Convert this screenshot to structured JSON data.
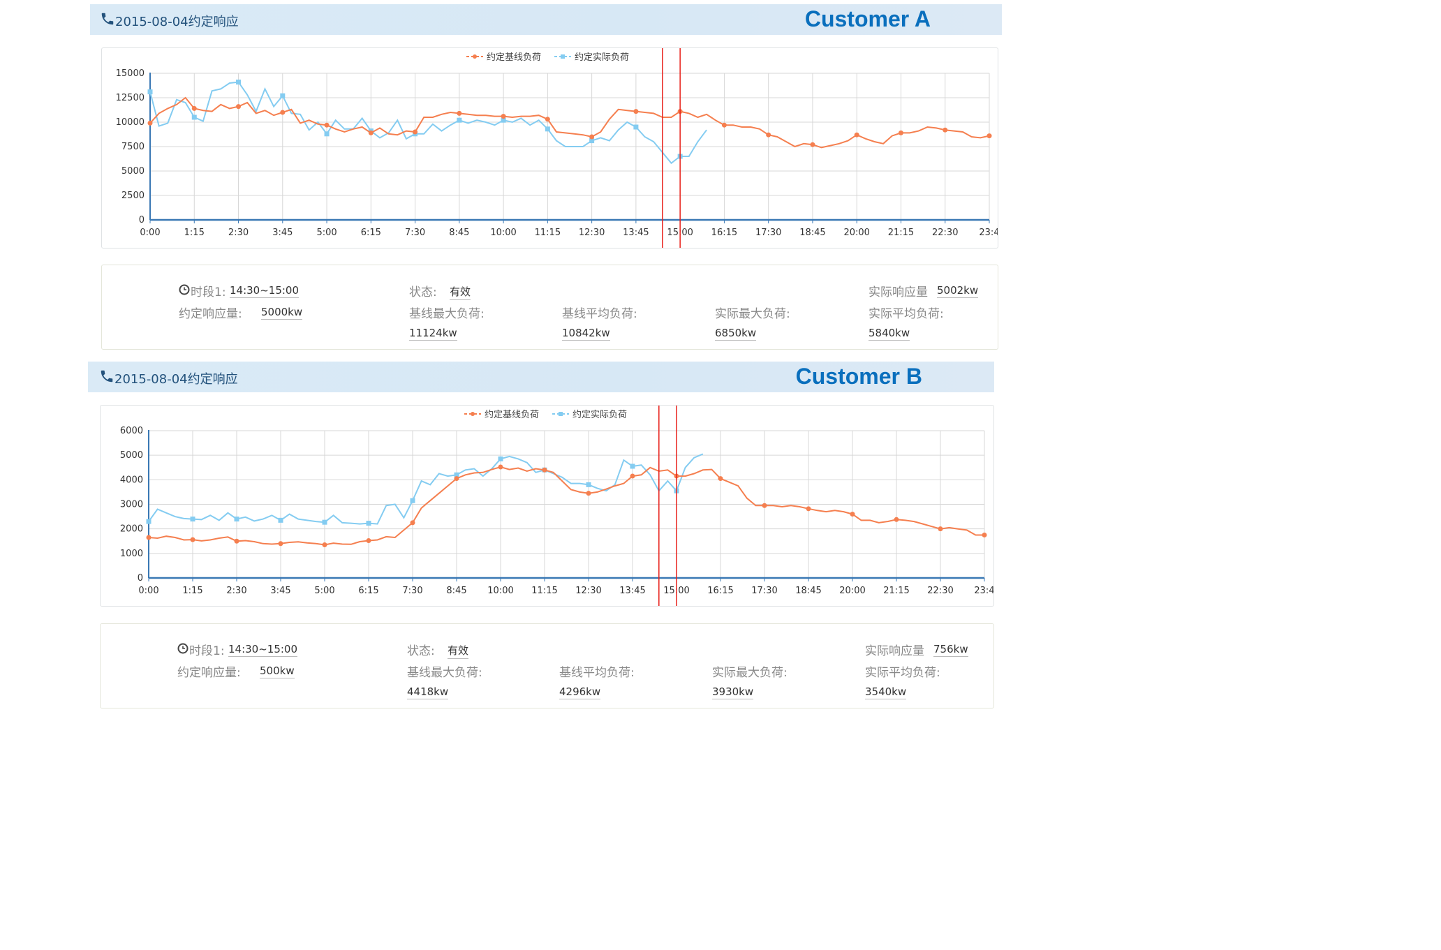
{
  "panels": [
    {
      "header": {
        "date_title": "2015-08-04约定响应",
        "customer_label": "Customer A"
      },
      "chart_data": {
        "type": "line",
        "legend": [
          "约定基线负荷",
          "约定实际负荷"
        ],
        "x_ticks": [
          "0:00",
          "1:15",
          "2:30",
          "3:45",
          "5:00",
          "6:15",
          "7:30",
          "8:45",
          "10:00",
          "11:15",
          "12:30",
          "13:45",
          "15:00",
          "16:15",
          "17:30",
          "18:45",
          "20:00",
          "21:15",
          "22:30",
          "23:4"
        ],
        "ylim": [
          0,
          15000
        ],
        "y_ticks": [
          0,
          2500,
          5000,
          7500,
          10000,
          12500,
          15000
        ],
        "response_window": [
          "14:30",
          "15:00"
        ],
        "series": [
          {
            "name": "约定基线负荷",
            "color": "#f57f4f",
            "x": [
              0,
              0.25,
              0.5,
              0.75,
              1,
              1.25,
              1.5,
              1.75,
              2,
              2.25,
              2.5,
              2.75,
              3,
              3.25,
              3.5,
              3.75,
              4,
              4.25,
              4.5,
              4.75,
              5,
              5.25,
              5.5,
              5.75,
              6,
              6.25,
              6.5,
              6.75,
              7,
              7.25,
              7.5,
              7.75,
              8,
              8.25,
              8.5,
              8.75,
              9,
              9.25,
              9.5,
              9.75,
              10,
              10.25,
              10.5,
              10.75,
              11,
              11.25,
              11.5,
              11.75,
              12,
              12.25,
              12.5,
              12.75,
              13,
              13.25,
              13.5,
              13.75,
              14,
              14.25,
              14.5,
              14.75,
              15,
              15.25,
              15.5,
              15.75,
              16,
              16.25,
              16.5,
              16.75,
              17,
              17.25,
              17.5,
              17.75,
              18,
              18.25,
              18.5,
              18.75,
              19,
              19.25,
              19.5,
              19.75,
              20,
              20.25,
              20.5,
              20.75,
              21,
              21.25,
              21.5,
              21.75,
              22,
              22.25,
              22.5,
              22.75,
              23,
              23.25,
              23.5,
              23.75
            ],
            "y": [
              9900,
              10900,
              11400,
              11800,
              12500,
              11400,
              11200,
              11100,
              11800,
              11400,
              11600,
              12000,
              10900,
              11200,
              10700,
              11000,
              11300,
              9900,
              10200,
              9800,
              9700,
              9300,
              9000,
              9300,
              9500,
              8900,
              9400,
              8800,
              8700,
              9100,
              9000,
              10500,
              10500,
              10800,
              11000,
              10900,
              10800,
              10700,
              10700,
              10600,
              10600,
              10500,
              10600,
              10600,
              10700,
              10300,
              9000,
              8900,
              8800,
              8700,
              8500,
              9000,
              10300,
              11300,
              11200,
              11100,
              11000,
              10900,
              10500,
              10500,
              11100,
              10900,
              10500,
              10800,
              10200,
              9700,
              9700,
              9500,
              9500,
              9300,
              8700,
              8500,
              8000,
              7500,
              7800,
              7700,
              7400,
              7600,
              7800,
              8100,
              8700,
              8300,
              8000,
              7800,
              8600,
              8900,
              8900,
              9100,
              9500,
              9400,
              9200,
              9100,
              9000,
              8500,
              8400,
              8600
            ]
          },
          {
            "name": "约定实际负荷",
            "color": "#84ccf1",
            "x": [
              0,
              0.25,
              0.5,
              0.75,
              1,
              1.25,
              1.5,
              1.75,
              2,
              2.25,
              2.5,
              2.75,
              3,
              3.25,
              3.5,
              3.75,
              4,
              4.25,
              4.5,
              4.75,
              5,
              5.25,
              5.5,
              5.75,
              6,
              6.25,
              6.5,
              6.75,
              7,
              7.25,
              7.5,
              7.75,
              8,
              8.25,
              8.5,
              8.75,
              9,
              9.25,
              9.5,
              9.75,
              10,
              10.25,
              10.5,
              10.75,
              11,
              11.25,
              11.5,
              11.75,
              12,
              12.25,
              12.5,
              12.75,
              13,
              13.25,
              13.5,
              13.75,
              14,
              14.25,
              14.5,
              14.75,
              15,
              15.25,
              15.5,
              15.75
            ],
            "y": [
              13100,
              9600,
              9900,
              12300,
              12000,
              10500,
              10100,
              13200,
              13400,
              14000,
              14100,
              12800,
              11100,
              13400,
              11600,
              12700,
              10900,
              10800,
              9200,
              10000,
              8800,
              10200,
              9300,
              9300,
              10400,
              9100,
              8400,
              8900,
              10200,
              8300,
              8800,
              8800,
              9800,
              9100,
              9700,
              10200,
              9900,
              10200,
              10000,
              9700,
              10200,
              10000,
              10400,
              9700,
              10200,
              9300,
              8100,
              7500,
              7500,
              7500,
              8100,
              8400,
              8100,
              9200,
              10000,
              9500,
              8500,
              8000,
              6900,
              5800,
              6500,
              6500,
              8000,
              9200
            ]
          }
        ]
      },
      "info": {
        "period_label": "时段1:",
        "period_value": "14:30~15:00",
        "status_label": "状态:",
        "status_value": "有效",
        "actual_response_label": "实际响应量",
        "actual_response_value": "5002kw",
        "agreed_response_label": "约定响应量:",
        "agreed_response_value": "5000kw",
        "baseline_max_label": "基线最大负荷:",
        "baseline_max_value": "11124kw",
        "baseline_avg_label": "基线平均负荷:",
        "baseline_avg_value": "10842kw",
        "actual_max_label": "实际最大负荷:",
        "actual_max_value": "6850kw",
        "actual_avg_label": "实际平均负荷:",
        "actual_avg_value": "5840kw"
      }
    },
    {
      "header": {
        "date_title": "2015-08-04约定响应",
        "customer_label": "Customer B"
      },
      "chart_data": {
        "type": "line",
        "legend": [
          "约定基线负荷",
          "约定实际负荷"
        ],
        "x_ticks": [
          "0:00",
          "1:15",
          "2:30",
          "3:45",
          "5:00",
          "6:15",
          "7:30",
          "8:45",
          "10:00",
          "11:15",
          "12:30",
          "13:45",
          "15:00",
          "16:15",
          "17:30",
          "18:45",
          "20:00",
          "21:15",
          "22:30",
          "23:4"
        ],
        "ylim": [
          0,
          6000
        ],
        "y_ticks": [
          0,
          1000,
          2000,
          3000,
          4000,
          5000,
          6000
        ],
        "response_window": [
          "14:30",
          "15:00"
        ],
        "series": [
          {
            "name": "约定基线负荷",
            "color": "#f57f4f",
            "x": [
              0,
              0.25,
              0.5,
              0.75,
              1,
              1.25,
              1.5,
              1.75,
              2,
              2.25,
              2.5,
              2.75,
              3,
              3.25,
              3.5,
              3.75,
              4,
              4.25,
              4.5,
              4.75,
              5,
              5.25,
              5.5,
              5.75,
              6,
              6.25,
              6.5,
              6.75,
              7,
              7.25,
              7.5,
              7.75,
              8,
              8.25,
              8.5,
              8.75,
              9,
              9.25,
              9.5,
              9.75,
              10,
              10.25,
              10.5,
              10.75,
              11,
              11.25,
              11.5,
              11.75,
              12,
              12.25,
              12.5,
              12.75,
              13,
              13.25,
              13.5,
              13.75,
              14,
              14.25,
              14.5,
              14.75,
              15,
              15.25,
              15.5,
              15.75,
              16,
              16.25,
              16.5,
              16.75,
              17,
              17.25,
              17.5,
              17.75,
              18,
              18.25,
              18.5,
              18.75,
              19,
              19.25,
              19.5,
              19.75,
              20,
              20.25,
              20.5,
              20.75,
              21,
              21.25,
              21.5,
              21.75,
              22,
              22.25,
              22.5,
              22.75,
              23,
              23.25,
              23.5,
              23.75
            ],
            "y": [
              1650,
              1620,
              1700,
              1650,
              1550,
              1560,
              1510,
              1550,
              1620,
              1670,
              1500,
              1520,
              1480,
              1400,
              1380,
              1400,
              1450,
              1470,
              1430,
              1400,
              1350,
              1420,
              1380,
              1370,
              1480,
              1520,
              1550,
              1680,
              1650,
              1950,
              2250,
              2850,
              3150,
              3450,
              3750,
              4050,
              4200,
              4280,
              4300,
              4420,
              4520,
              4420,
              4480,
              4350,
              4450,
              4400,
              4300,
              3950,
              3600,
              3500,
              3450,
              3500,
              3620,
              3750,
              3850,
              4150,
              4200,
              4500,
              4350,
              4400,
              4150,
              4150,
              4250,
              4400,
              4420,
              4050,
              3900,
              3750,
              3250,
              2950,
              2950,
              2950,
              2900,
              2950,
              2900,
              2820,
              2750,
              2700,
              2750,
              2700,
              2600,
              2350,
              2350,
              2250,
              2300,
              2380,
              2350,
              2300,
              2200,
              2100,
              2000,
              2050,
              2000,
              1950,
              1750,
              1750
            ]
          },
          {
            "name": "约定实际负荷",
            "color": "#84ccf1",
            "x": [
              0,
              0.25,
              0.5,
              0.75,
              1,
              1.25,
              1.5,
              1.75,
              2,
              2.25,
              2.5,
              2.75,
              3,
              3.25,
              3.5,
              3.75,
              4,
              4.25,
              4.5,
              4.75,
              5,
              5.25,
              5.5,
              5.75,
              6,
              6.25,
              6.5,
              6.75,
              7,
              7.25,
              7.5,
              7.75,
              8,
              8.25,
              8.5,
              8.75,
              9,
              9.25,
              9.5,
              9.75,
              10,
              10.25,
              10.5,
              10.75,
              11,
              11.25,
              11.5,
              11.75,
              12,
              12.25,
              12.5,
              12.75,
              13,
              13.25,
              13.5,
              13.75,
              14,
              14.25,
              14.5,
              14.75,
              15,
              15.25,
              15.5,
              15.75
            ],
            "y": [
              2300,
              2800,
              2650,
              2500,
              2420,
              2400,
              2380,
              2550,
              2350,
              2650,
              2400,
              2480,
              2320,
              2400,
              2550,
              2350,
              2600,
              2400,
              2350,
              2300,
              2270,
              2550,
              2250,
              2230,
              2200,
              2230,
              2200,
              2950,
              3000,
              2450,
              3150,
              3950,
              3800,
              4250,
              4150,
              4200,
              4400,
              4450,
              4150,
              4450,
              4850,
              4950,
              4850,
              4700,
              4300,
              4400,
              4250,
              4100,
              3850,
              3850,
              3800,
              3650,
              3550,
              3800,
              4800,
              4550,
              4600,
              4200,
              3550,
              3950,
              3550,
              4500,
              4900,
              5050
            ]
          }
        ]
      },
      "info": {
        "period_label": "时段1:",
        "period_value": "14:30~15:00",
        "status_label": "状态:",
        "status_value": "有效",
        "actual_response_label": "实际响应量",
        "actual_response_value": "756kw",
        "agreed_response_label": "约定响应量:",
        "agreed_response_value": "500kw",
        "baseline_max_label": "基线最大负荷:",
        "baseline_max_value": "4418kw",
        "baseline_avg_label": "基线平均负荷:",
        "baseline_avg_value": "4296kw",
        "actual_max_label": "实际最大负荷:",
        "actual_max_value": "3930kw",
        "actual_avg_label": "实际平均负荷:",
        "actual_avg_value": "3540kw"
      }
    }
  ]
}
